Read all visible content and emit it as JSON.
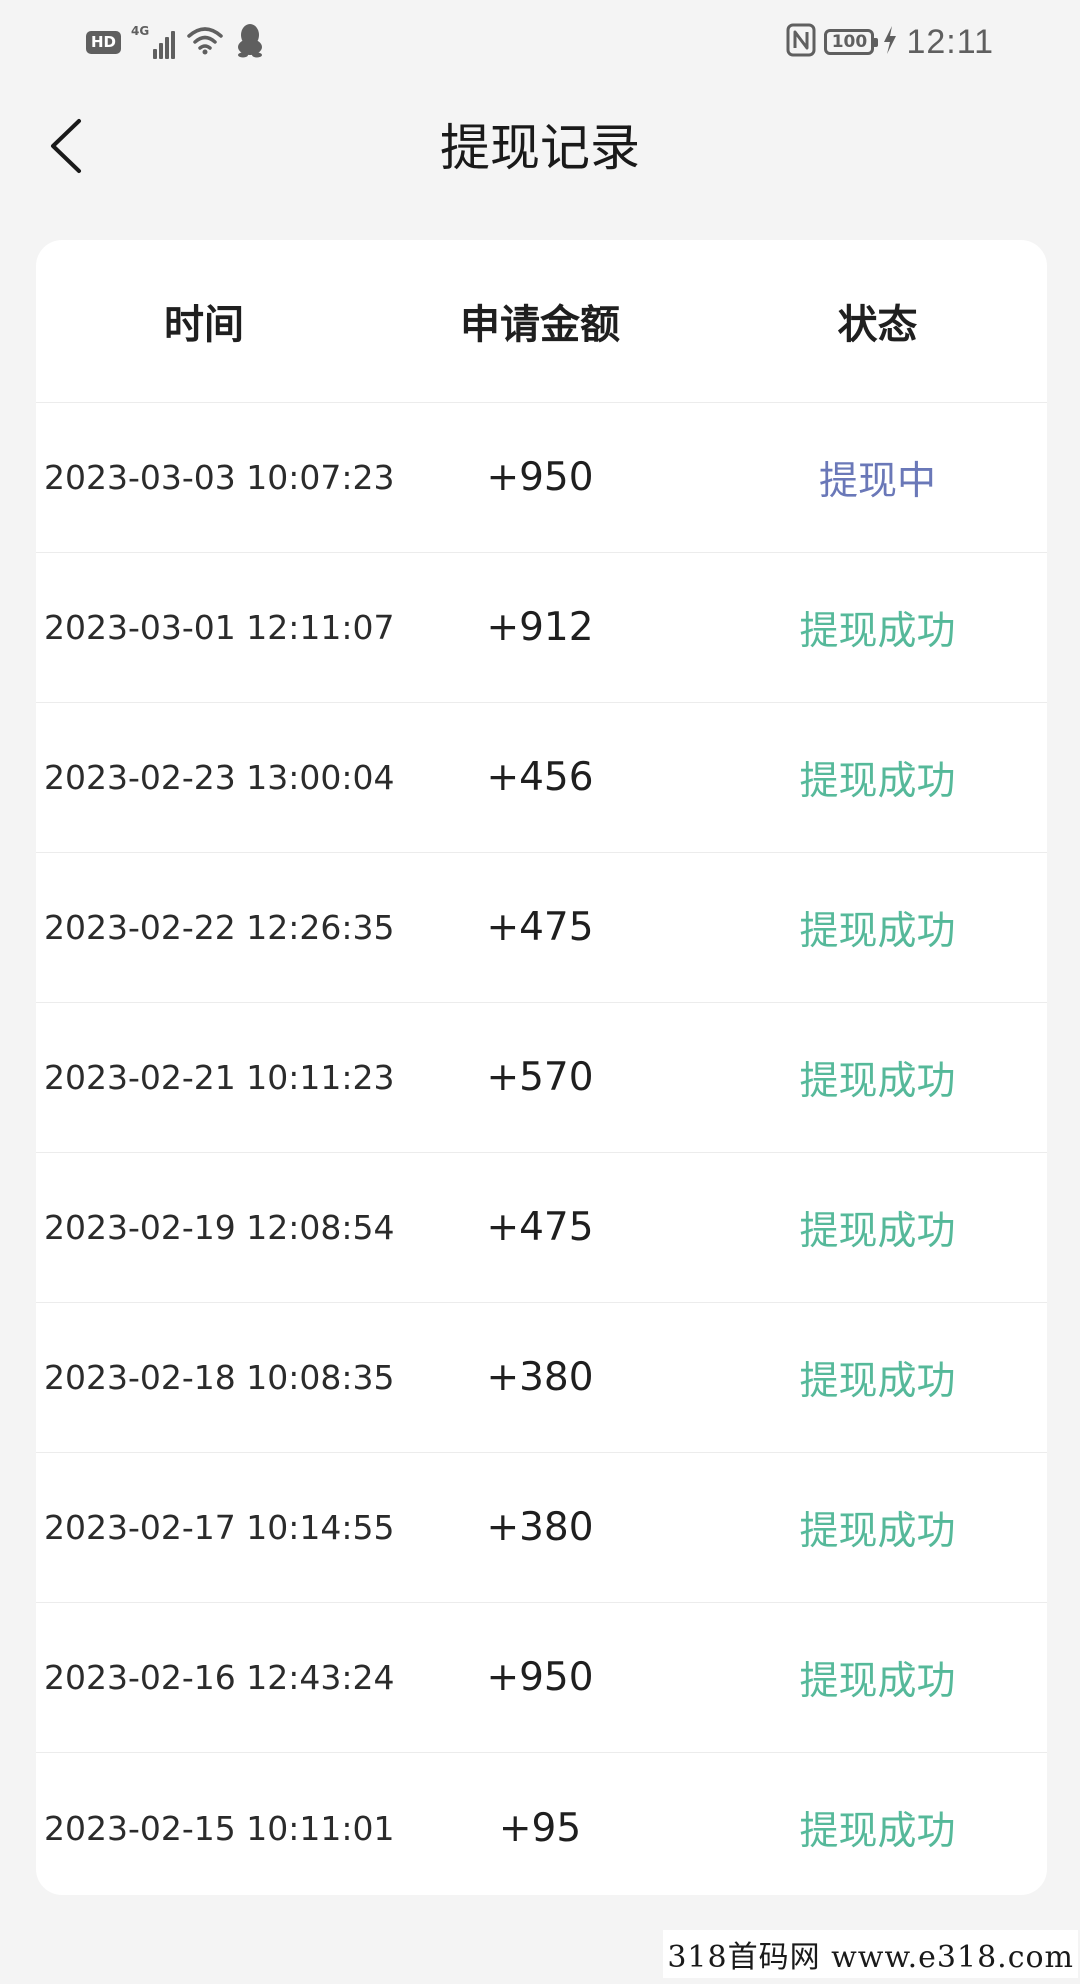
{
  "status_bar": {
    "hd_label": "HD",
    "network_label": "4G",
    "battery_level": "100",
    "time": "12:11",
    "icons": [
      "hd-icon",
      "cellular-signal-icon",
      "wifi-icon",
      "qq-penguin-icon",
      "nfc-icon",
      "battery-icon",
      "charging-bolt-icon"
    ]
  },
  "nav": {
    "back_icon": "chevron-left-icon",
    "title": "提现记录"
  },
  "table": {
    "headers": {
      "time": "时间",
      "amount": "申请金额",
      "status": "状态"
    },
    "rows": [
      {
        "time": "2023-03-03 10:07:23",
        "amount": "+950",
        "status": "提现中",
        "state": "pending"
      },
      {
        "time": "2023-03-01 12:11:07",
        "amount": "+912",
        "status": "提现成功",
        "state": "success"
      },
      {
        "time": "2023-02-23 13:00:04",
        "amount": "+456",
        "status": "提现成功",
        "state": "success"
      },
      {
        "time": "2023-02-22 12:26:35",
        "amount": "+475",
        "status": "提现成功",
        "state": "success"
      },
      {
        "time": "2023-02-21 10:11:23",
        "amount": "+570",
        "status": "提现成功",
        "state": "success"
      },
      {
        "time": "2023-02-19 12:08:54",
        "amount": "+475",
        "status": "提现成功",
        "state": "success"
      },
      {
        "time": "2023-02-18 10:08:35",
        "amount": "+380",
        "status": "提现成功",
        "state": "success"
      },
      {
        "time": "2023-02-17 10:14:55",
        "amount": "+380",
        "status": "提现成功",
        "state": "success"
      },
      {
        "time": "2023-02-16 12:43:24",
        "amount": "+950",
        "status": "提现成功",
        "state": "success"
      },
      {
        "time": "2023-02-15 10:11:01",
        "amount": "+95",
        "status": "提现成功",
        "state": "success"
      }
    ]
  },
  "watermark": "318首码网 www.e318.com",
  "colors": {
    "background": "#f4f4f4",
    "card": "#ffffff",
    "status_pending": "#6a78b8",
    "status_success": "#56b99a"
  }
}
